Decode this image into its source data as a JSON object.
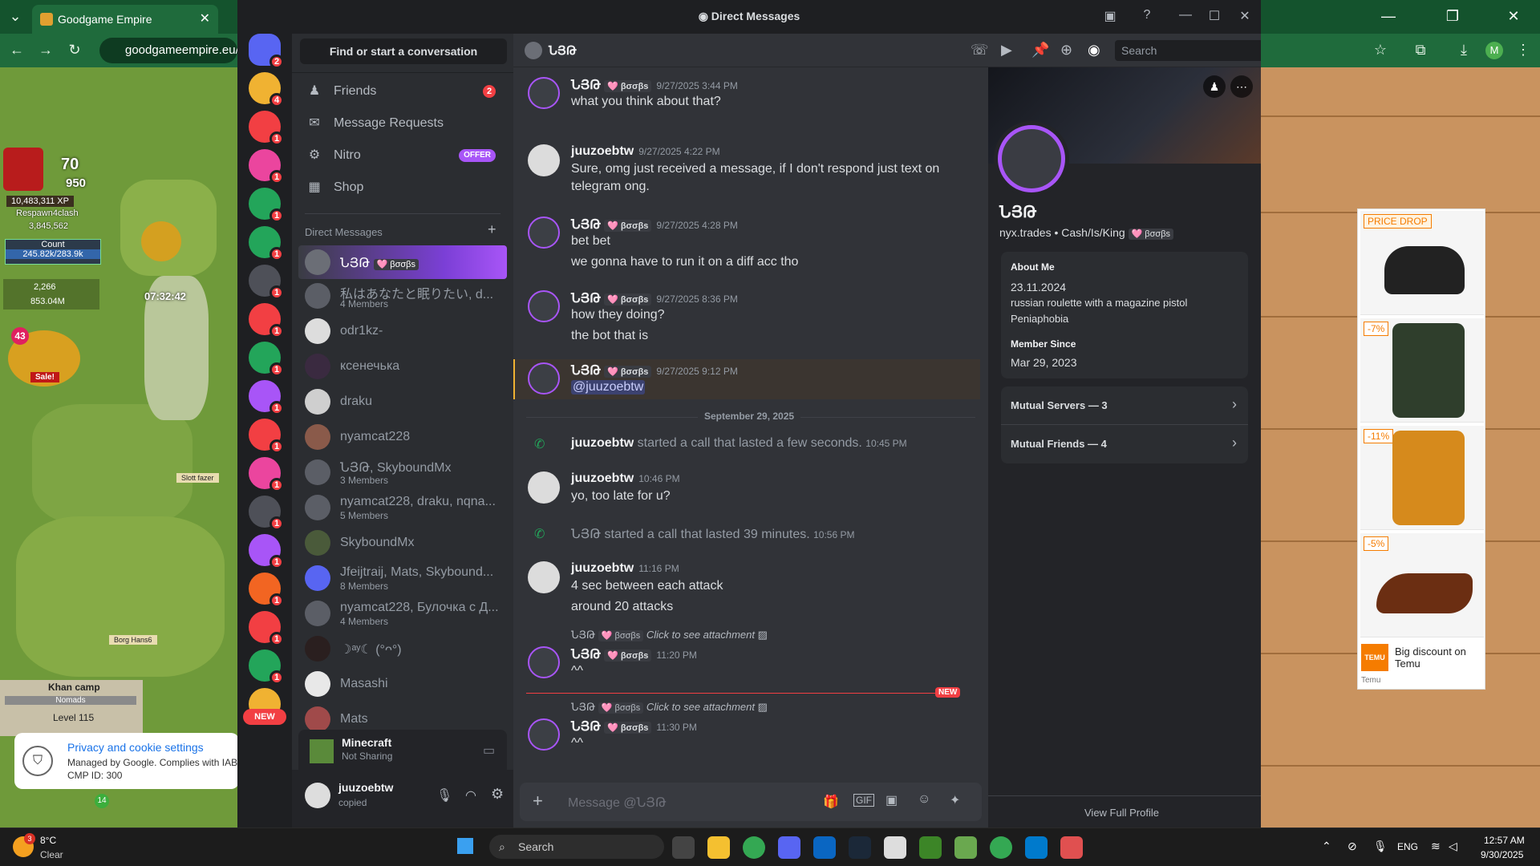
{
  "browser": {
    "tab_title": "Goodgame Empire",
    "url": "goodgameempire.eu/",
    "avatar_letter": "M"
  },
  "game": {
    "xp": "10,483,311 XP",
    "level_top": "70",
    "level_sub": "950",
    "player": "Respawn4clash",
    "resource1": "3,845,562",
    "timer": "07:32:42",
    "count_label": "Count",
    "count_value": "245.82k/283.9k",
    "res_a": "2,266",
    "res_b": "853.04M",
    "badge_num": "43",
    "sale": "Sale!",
    "castle1": "Slott fazer",
    "castle2": "Borg Hans6",
    "camp_title": "Khan camp",
    "camp_sub": "Nomads",
    "camp_level": "Level 115",
    "num14": "14"
  },
  "privacy": {
    "title": "Privacy and cookie settings",
    "line1": "Managed by Google. Complies with IAB",
    "line2": "CMP ID: 300"
  },
  "ad": {
    "price_drop": "PRICE DROP",
    "d1": "-7%",
    "d2": "-11%",
    "d3": "-5%",
    "footer": "Big discount on Temu",
    "brand": "Temu",
    "logo": "TEMU"
  },
  "discord": {
    "window_title": "Direct Messages",
    "find_conversation": "Find or start a conversation",
    "nav": [
      {
        "label": "Friends",
        "badge": "2"
      },
      {
        "label": "Message Requests"
      },
      {
        "label": "Nitro",
        "badge": "OFFER"
      },
      {
        "label": "Shop"
      }
    ],
    "dm_header": "Direct Messages",
    "dms": [
      {
        "name": "ՆՅԹ",
        "tag": "🩷 βσσβs",
        "sub": ""
      },
      {
        "name": "私はあなたと眠りたい, d...",
        "sub": "4 Members"
      },
      {
        "name": "odr1kz-",
        "sub": ""
      },
      {
        "name": "ксенечька",
        "sub": ""
      },
      {
        "name": "draku",
        "sub": ""
      },
      {
        "name": "nyamcat228",
        "sub": ""
      },
      {
        "name": "ՆՅԹ, SkyboundMx",
        "sub": "3 Members"
      },
      {
        "name": "nyamcat228, draku, nqna...",
        "sub": "5 Members"
      },
      {
        "name": "SkyboundMx",
        "sub": ""
      },
      {
        "name": "Jfeijtraij, Mats, Skybound...",
        "sub": "8 Members"
      },
      {
        "name": "nyamcat228, Булочка с Д...",
        "sub": "4 Members"
      },
      {
        "name": "☽ᵃʸ☾ (°ᴖ°)",
        "sub": ""
      },
      {
        "name": "Masashi",
        "sub": ""
      },
      {
        "name": "Mats",
        "sub": ""
      }
    ],
    "guild_badges": [
      "2",
      "4",
      "1",
      "1",
      "1",
      "1",
      "1",
      "1",
      "1",
      "1",
      "1",
      "1",
      "1",
      "1",
      "1",
      "1",
      "1"
    ],
    "guild_new": "NEW",
    "activity": {
      "game": "Minecraft",
      "status": "Not Sharing"
    },
    "user": {
      "name": "juuzoebtw",
      "status": "copied"
    },
    "chat_title": "ՆՅԹ",
    "search_placeholder": "Search",
    "messages": [
      {
        "author": "ՆՅԹ",
        "tag": "🩷 βσσβs",
        "time": "9/27/2025 3:44 PM",
        "lines": [
          "what you think about that?"
        ]
      },
      {
        "author": "juuzoebtw",
        "time": "9/27/2025 4:22 PM",
        "lines": [
          "Sure, omg just received a message, if I don't respond just text on",
          "telegram ong."
        ]
      },
      {
        "author": "ՆՅԹ",
        "tag": "🩷 βσσβs",
        "time": "9/27/2025 4:28 PM",
        "lines": [
          "bet bet",
          "we gonna have to run it on a diff acc tho"
        ]
      },
      {
        "author": "ՆՅԹ",
        "tag": "🩷 βσσβs",
        "time": "9/27/2025 8:36 PM",
        "lines": [
          "how they doing?",
          "the bot that is"
        ]
      },
      {
        "author": "ՆՅԹ",
        "tag": "🩷 βσσβs",
        "time": "9/27/2025 9:12 PM",
        "lines": [
          "@juuzoebtw"
        ]
      },
      {
        "author": "juuzoebtw",
        "time": "10:46 PM",
        "lines": [
          "yo, too late for u?"
        ]
      },
      {
        "author": "juuzoebtw",
        "time": "11:16 PM",
        "lines": [
          "4 sec between each attack",
          "around 20 attacks"
        ]
      },
      {
        "author": "ՆՅԹ",
        "tag": "🩷 βσσβs",
        "time": "11:20 PM",
        "lines": [
          "^^"
        ]
      },
      {
        "author": "ՆՅԹ",
        "tag": "🩷 βσσβs",
        "time": "11:30 PM",
        "lines": [
          "^^"
        ]
      }
    ],
    "date_divider": "September 29, 2025",
    "call1": {
      "who": "juuzoebtw",
      "text": "started a call that lasted a few seconds.",
      "time": "10:45 PM"
    },
    "call2": {
      "who": "ՆՅԹ",
      "text": "started a call that lasted 39 minutes.",
      "time": "10:56 PM"
    },
    "reply": {
      "author": "ՆՅԹ",
      "tag": "🩷 βσσβs",
      "text": "Click to see attachment"
    },
    "new_label": "NEW",
    "composer_placeholder": "Message @ՆՅԹ",
    "profile": {
      "name": "ՆՅԹ",
      "handle": "nyx.trades",
      "pronouns": "Cash/Is/King",
      "tag": "🩷 βσσβs",
      "about_label": "About Me",
      "about_lines": [
        "23.11.2024",
        "russian roulette with a magazine pistol",
        "Peniaphobia"
      ],
      "member_since_label": "Member Since",
      "member_since": "Mar 29, 2023",
      "mutual_servers": "Mutual Servers — 3",
      "mutual_friends": "Mutual Friends — 4",
      "view_full": "View Full Profile"
    }
  },
  "taskbar": {
    "temp": "8°C",
    "weather": "Clear",
    "weather_badge": "3",
    "search": "Search",
    "lang": "ENG",
    "time": "12:57 AM",
    "date": "9/30/2025"
  },
  "colors": {
    "blurple": "#5865f2",
    "red": "#f23f43",
    "green": "#23a55a",
    "purple": "#a855f7"
  }
}
